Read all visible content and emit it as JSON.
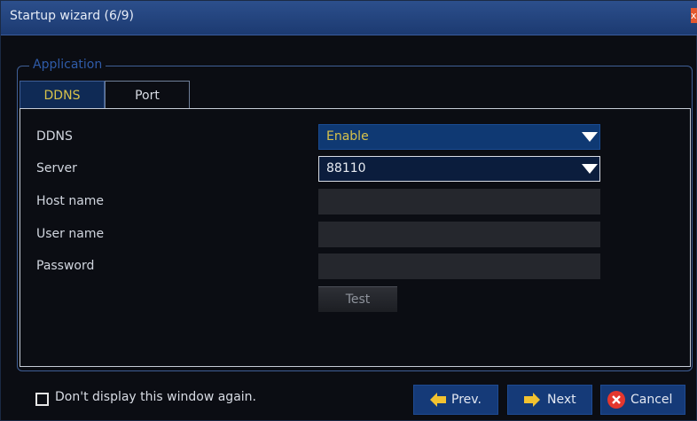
{
  "window": {
    "title": "Startup wizard (6/9)",
    "close_glyph": "x"
  },
  "group": {
    "legend": "Application"
  },
  "tabs": [
    {
      "label": "DDNS",
      "active": true
    },
    {
      "label": "Port",
      "active": false
    }
  ],
  "form": {
    "ddns": {
      "label": "DDNS",
      "value": "Enable"
    },
    "server": {
      "label": "Server",
      "value": "88110"
    },
    "host_name": {
      "label": "Host name",
      "value": ""
    },
    "user_name": {
      "label": "User name",
      "value": ""
    },
    "password": {
      "label": "Password",
      "value": ""
    },
    "test_label": "Test"
  },
  "footer": {
    "checkbox_label": "Don't display this window again.",
    "checked": false,
    "prev_label": "Prev.",
    "next_label": "Next",
    "cancel_label": "Cancel"
  },
  "icons": {
    "prev": "arrow-left-icon",
    "next": "arrow-right-icon",
    "cancel": "cancel-x-icon",
    "dropdown": "dropdown-arrow-icon"
  },
  "colors": {
    "titlebar": "#1c3a71",
    "accent_text": "#d8c24a",
    "button": "#153a78",
    "arrow_icon": "#f2c230",
    "cancel_icon": "#e4372e"
  }
}
